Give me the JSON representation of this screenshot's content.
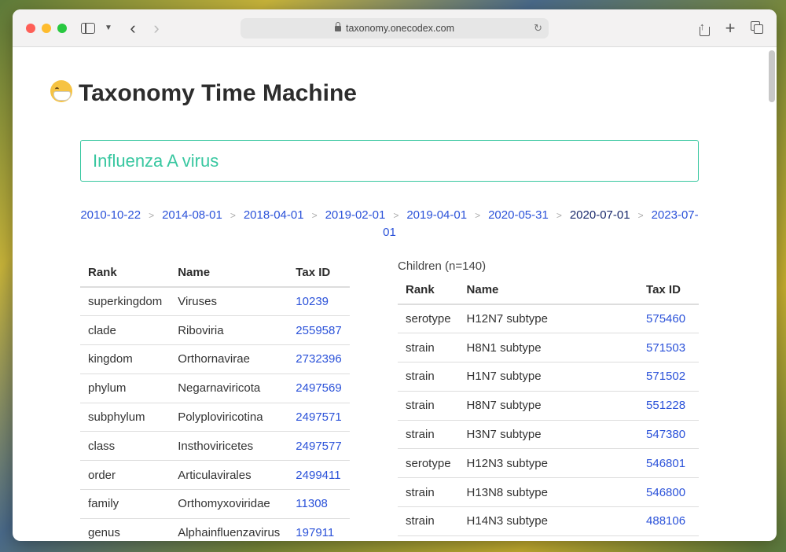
{
  "browser": {
    "url": "taxonomy.onecodex.com"
  },
  "page": {
    "title": "Taxonomy Time Machine",
    "search_value": "Influenza A virus"
  },
  "versions": [
    {
      "label": "2010-10-22",
      "current": false
    },
    {
      "label": "2014-08-01",
      "current": false
    },
    {
      "label": "2018-04-01",
      "current": false
    },
    {
      "label": "2019-02-01",
      "current": false
    },
    {
      "label": "2019-04-01",
      "current": false
    },
    {
      "label": "2020-05-31",
      "current": false
    },
    {
      "label": "2020-07-01",
      "current": true
    },
    {
      "label": "2023-07-01",
      "current": false
    }
  ],
  "version_separator": ">",
  "lineage": {
    "headers": {
      "rank": "Rank",
      "name": "Name",
      "taxid": "Tax ID"
    },
    "rows": [
      {
        "rank": "superkingdom",
        "name": "Viruses",
        "taxid": "10239"
      },
      {
        "rank": "clade",
        "name": "Riboviria",
        "taxid": "2559587"
      },
      {
        "rank": "kingdom",
        "name": "Orthornavirae",
        "taxid": "2732396"
      },
      {
        "rank": "phylum",
        "name": "Negarnaviricota",
        "taxid": "2497569"
      },
      {
        "rank": "subphylum",
        "name": "Polyploviricotina",
        "taxid": "2497571"
      },
      {
        "rank": "class",
        "name": "Insthoviricetes",
        "taxid": "2497577"
      },
      {
        "rank": "order",
        "name": "Articulavirales",
        "taxid": "2499411"
      },
      {
        "rank": "family",
        "name": "Orthomyxoviridae",
        "taxid": "11308"
      },
      {
        "rank": "genus",
        "name": "Alphainfluenzavirus",
        "taxid": "197911"
      }
    ]
  },
  "children": {
    "caption": "Children (n=140)",
    "headers": {
      "rank": "Rank",
      "name": "Name",
      "taxid": "Tax ID"
    },
    "rows": [
      {
        "rank": "serotype",
        "name": "H12N7 subtype",
        "taxid": "575460"
      },
      {
        "rank": "strain",
        "name": "H8N1 subtype",
        "taxid": "571503"
      },
      {
        "rank": "strain",
        "name": "H1N7 subtype",
        "taxid": "571502"
      },
      {
        "rank": "strain",
        "name": "H8N7 subtype",
        "taxid": "551228"
      },
      {
        "rank": "strain",
        "name": "H3N7 subtype",
        "taxid": "547380"
      },
      {
        "rank": "serotype",
        "name": "H12N3 subtype",
        "taxid": "546801"
      },
      {
        "rank": "strain",
        "name": "H13N8 subtype",
        "taxid": "546800"
      },
      {
        "rank": "strain",
        "name": "H14N3 subtype",
        "taxid": "488106"
      }
    ]
  }
}
